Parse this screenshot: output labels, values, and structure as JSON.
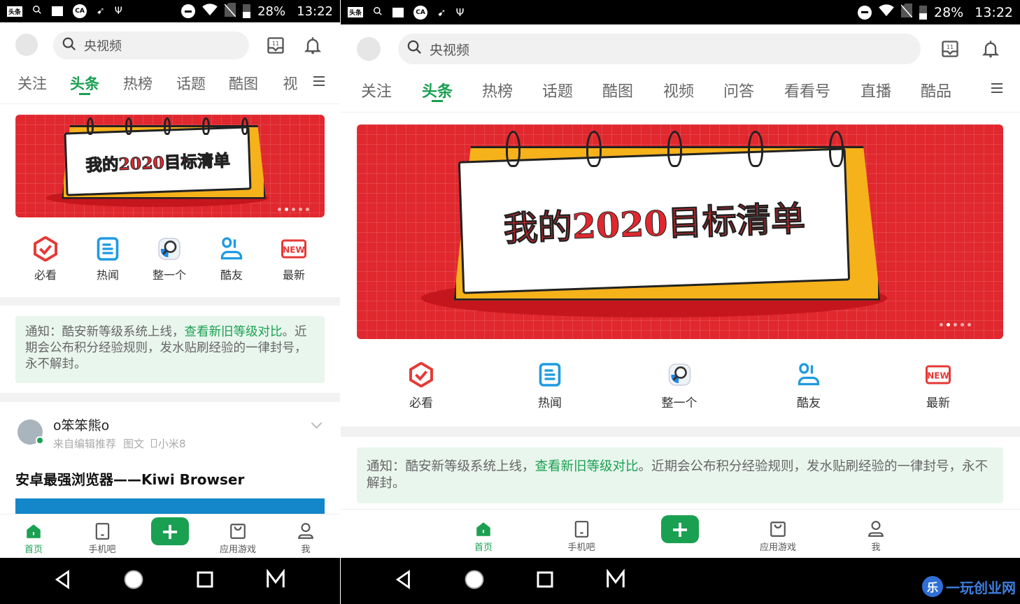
{
  "colors": {
    "accent": "#1aa051",
    "banner_red": "#e0282e",
    "notice_bg": "#e9f6ee"
  },
  "status_bar": {
    "battery": "28%",
    "time": "13:22",
    "app_badge": "头条",
    "icons": [
      "search-icon",
      "image-icon",
      "coolapk-icon",
      "send-icon",
      "usb-icon",
      "dnd-icon",
      "wifi-icon",
      "no-sim-icon",
      "battery-charging-icon"
    ]
  },
  "header": {
    "search_placeholder": "央视频",
    "calendar_badge": "11",
    "icons": [
      "avatar",
      "search-icon",
      "calendar-icon",
      "bell-icon"
    ]
  },
  "tabs": [
    {
      "label": "关注"
    },
    {
      "label": "头条",
      "active": true
    },
    {
      "label": "热榜"
    },
    {
      "label": "话题"
    },
    {
      "label": "酷图"
    },
    {
      "label": "视频"
    },
    {
      "label": "问答"
    },
    {
      "label": "看看号"
    },
    {
      "label": "直播"
    },
    {
      "label": "酷品"
    }
  ],
  "left_tabs_truncated": "视",
  "banner": {
    "title": "我的2020目标清单",
    "slides": 5,
    "current_slide": 2
  },
  "quick": [
    {
      "label": "必看",
      "icon": "check-shield-icon"
    },
    {
      "label": "热闻",
      "icon": "news-icon"
    },
    {
      "label": "整一个",
      "icon": "magnifier-icon"
    },
    {
      "label": "酷友",
      "icon": "friends-icon"
    },
    {
      "label": "最新",
      "icon": "new-badge-icon"
    }
  ],
  "new_badge_text": "NEW",
  "notice": {
    "prefix": "通知：酷安新等级系统上线，",
    "link": "查看新旧等级对比",
    "suffix": "。近期会公布积分经验规则，发水贴刷经验的一律封号，永不解封。"
  },
  "post": {
    "author": "o笨笨熊o",
    "source": "来自编辑推荐",
    "type": "图文",
    "device": "小米8",
    "title": "安卓最强浏览器——Kiwi Browser"
  },
  "bottom_nav": [
    {
      "label": "首页",
      "icon": "home-icon",
      "active": true
    },
    {
      "label": "手机吧",
      "icon": "phone-icon"
    },
    {
      "label": "",
      "icon": "plus-icon"
    },
    {
      "label": "应用游戏",
      "icon": "app-store-icon"
    },
    {
      "label": "我",
      "icon": "user-icon"
    }
  ],
  "android_nav": [
    "back-icon",
    "home-circle-icon",
    "recents-icon",
    "m-icon"
  ],
  "watermark": {
    "text": "一玩创业网"
  }
}
